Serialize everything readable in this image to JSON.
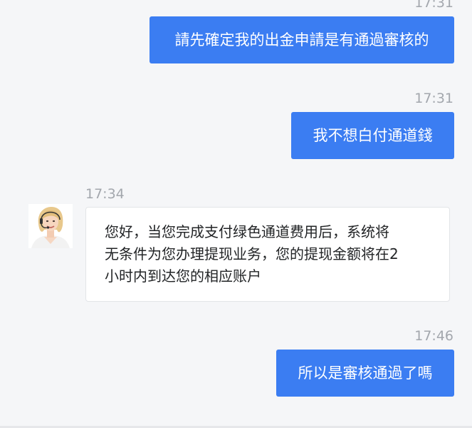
{
  "messages": [
    {
      "time": "17:31",
      "text": "請先確定我的出金申請是有通過審核的",
      "direction": "outgoing"
    },
    {
      "time": "17:31",
      "text": "我不想白付通道錢",
      "direction": "outgoing"
    },
    {
      "time": "17:34",
      "lines": [
        "您好，当您完成支付绿色通道费用后，系统将",
        "无条件为您办理提现业务，您的提现金额将在2",
        "小时内到达您的相应账户"
      ],
      "direction": "incoming"
    },
    {
      "time": "17:46",
      "text": "所以是審核通過了嗎",
      "direction": "outgoing"
    }
  ],
  "colors": {
    "background": "#f5f6f8",
    "outgoing_bubble": "#3b7df2",
    "incoming_bubble": "#ffffff",
    "timestamp": "#a3a7ad"
  },
  "icons": {
    "agent_avatar": "customer-service-agent-avatar"
  }
}
